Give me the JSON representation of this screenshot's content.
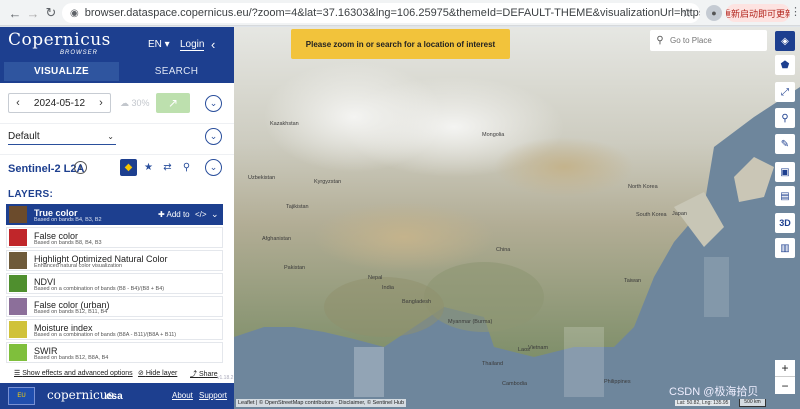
{
  "browser": {
    "url": "browser.dataspace.copernicus.eu/?zoom=4&lat=37.16303&lng=106.25975&themeId=DEFAULT-THEME&visualizationUrl=https%3A%2F%2Fsh.dataspace.copernicus.eu...",
    "update_button": "重新启动即可更新"
  },
  "header": {
    "logo": "Copernicus",
    "logo_sub": "BROWSER",
    "language": "EN",
    "login": "Login"
  },
  "tabs": [
    {
      "label": "VISUALIZE",
      "active": true
    },
    {
      "label": "SEARCH",
      "active": false
    }
  ],
  "date": {
    "value": "2024-05-12"
  },
  "cloud": {
    "value": "30%"
  },
  "theme": {
    "value": "Default"
  },
  "satellite": {
    "name": "Sentinel-2 L2A"
  },
  "layers": {
    "title": "LAYERS:",
    "add_label": "Add to",
    "items": [
      {
        "name": "True color",
        "desc": "Based on bands B4, B3, B2",
        "selected": true,
        "color": "#6b4b2c"
      },
      {
        "name": "False color",
        "desc": "Based on bands B8, B4, B3",
        "selected": false,
        "color": "#c0262a"
      },
      {
        "name": "Highlight Optimized Natural Color",
        "desc": "Enhanced natural color visualization",
        "selected": false,
        "color": "#6e5a3a"
      },
      {
        "name": "NDVI",
        "desc": "Based on a combination of bands (B8 - B4)/(B8 + B4)",
        "selected": false,
        "color": "#4f8f2e"
      },
      {
        "name": "False color (urban)",
        "desc": "Based on bands B12, B11, B4",
        "selected": false,
        "color": "#8c6f9a"
      },
      {
        "name": "Moisture index",
        "desc": "Based on a combination of bands (B8A - B11)/(B8A + B11)",
        "selected": false,
        "color": "#d0c23a"
      },
      {
        "name": "SWIR",
        "desc": "Based on bands B12, B8A, B4",
        "selected": false,
        "color": "#7fbf3c"
      }
    ]
  },
  "bottom_links": {
    "effects": "Show effects and advanced options",
    "hide": "Hide layer",
    "share": "Share"
  },
  "footer": {
    "eu": "EU",
    "copernicus": "copernicus",
    "esa": "esa",
    "about": "About",
    "support": "Support",
    "version": "v1.18.2"
  },
  "map": {
    "notice": "Please zoom in or search for a location of interest",
    "search_placeholder": "Go to Place",
    "labels": [
      {
        "text": "Kazakhstan"
      },
      {
        "text": "Mongolia"
      },
      {
        "text": "Uzbekistan"
      },
      {
        "text": "Kyrgyzstan"
      },
      {
        "text": "Tajikistan"
      },
      {
        "text": "Afghanistan"
      },
      {
        "text": "Pakistan"
      },
      {
        "text": "China"
      },
      {
        "text": "Nepal"
      },
      {
        "text": "India"
      },
      {
        "text": "Bangladesh"
      },
      {
        "text": "Myanmar (Burma)"
      },
      {
        "text": "Thailand"
      },
      {
        "text": "Laos"
      },
      {
        "text": "Vietnam"
      },
      {
        "text": "Cambodia"
      },
      {
        "text": "Philippines"
      },
      {
        "text": "North Korea"
      },
      {
        "text": "South Korea"
      },
      {
        "text": "Japan"
      },
      {
        "text": "Taiwan"
      }
    ],
    "attribution": "Leaflet | © OpenStreetMap contributors - Disclaimer, © Sentinel Hub",
    "coords": "Lat: 50.82, Lng: 135.95",
    "scale": "500 km",
    "tool_3d": "3D",
    "zoom_in": "+",
    "zoom_out": "−",
    "watermark": "CSDN @极海拾贝"
  },
  "colors": {
    "brand": "#1d3f8f",
    "notice": "#f2c33b"
  },
  "icons": [
    "back-icon",
    "forward-icon",
    "reload-icon",
    "lock-icon",
    "star-icon",
    "chevron-left-icon",
    "chevron-right-icon",
    "cloud-icon",
    "arrow-icon",
    "chevron-down-icon",
    "info-icon",
    "layers-icon",
    "star-outline-icon",
    "compare-icon",
    "pin-icon",
    "plus-icon",
    "code-icon",
    "expand-icon",
    "search-icon",
    "pentagon-icon",
    "measure-icon",
    "location-icon",
    "ruler-icon",
    "image-icon",
    "film-icon",
    "chart-icon"
  ]
}
